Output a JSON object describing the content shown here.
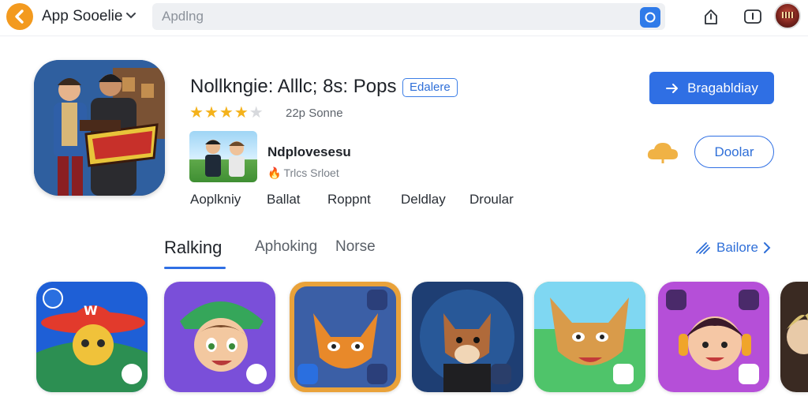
{
  "header": {
    "app_title": "App Sooelie",
    "search_placeholder": "Apdlng",
    "icons": [
      "logo-back-icon",
      "chevron-down-icon",
      "search-icon",
      "share-icon",
      "info-icon",
      "avatar"
    ]
  },
  "hero": {
    "title": "Nollkngie: Alllc; 8s: Pops",
    "badge": "Edalere",
    "rating_stars": 4,
    "rating_max": 5,
    "rating_text": "22p Sonne",
    "developer_name": "Ndplovesesu",
    "developer_sub": "Trlcs Srloet",
    "meta": [
      "Aoplkniy",
      "Ballat",
      "Roppnt",
      "Deldlay",
      "Droular"
    ],
    "install_label": "Bragabldiay",
    "secondary_label": "Doolar"
  },
  "tabs": [
    {
      "label": "Ralking",
      "active": true
    },
    {
      "label": "Aphoking",
      "active": false
    },
    {
      "label": "Norse",
      "active": false
    }
  ],
  "see_more_label": "Bailore",
  "tiles": [
    {
      "name": "tile-1",
      "bg": "#1e5fd6"
    },
    {
      "name": "tile-2",
      "bg": "#7a4fd9"
    },
    {
      "name": "tile-3",
      "bg": "#e9a23a"
    },
    {
      "name": "tile-4",
      "bg": "#1e3e73"
    },
    {
      "name": "tile-5",
      "bg": "#4fc46a"
    },
    {
      "name": "tile-6",
      "bg": "#b54fd8"
    }
  ],
  "colors": {
    "accent": "#2f6fe4",
    "star": "#f4b21b",
    "logo": "#f39a1f"
  }
}
